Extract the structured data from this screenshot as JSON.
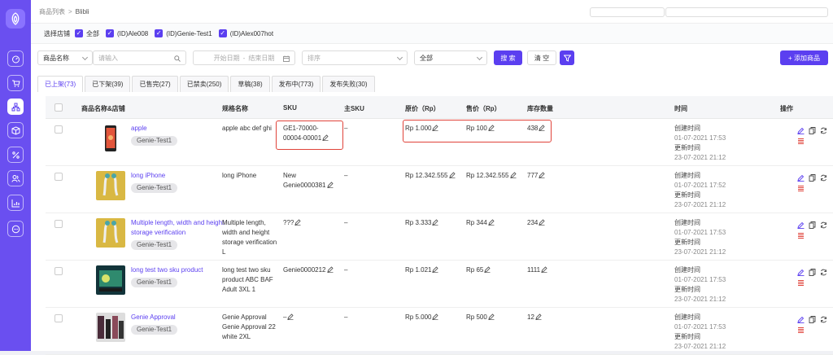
{
  "breadcrumb": {
    "parent": "商品列表",
    "separator": ">",
    "current": "Blibli"
  },
  "stores": {
    "label": "选择店铺",
    "options": [
      "全部",
      "(ID)Ale008",
      "(ID)Genie-Test1",
      "(ID)Alex007hot"
    ]
  },
  "filters": {
    "field": "商品名称",
    "search_placeholder": "请输入",
    "start_date": "开始日期",
    "date_sep": "-",
    "end_date": "结束日期",
    "sort": "排序",
    "status": "全部",
    "search_btn": "搜 索",
    "clear_btn": "清 空",
    "add_btn": "+ 添加商品"
  },
  "tabs": [
    "已上架(73)",
    "已下架(39)",
    "已售完(27)",
    "已禁卖(250)",
    "草稿(38)",
    "发布中(773)",
    "发布失败(30)"
  ],
  "columns": {
    "product": "商品名称&店铺",
    "spec": "规格名称",
    "sku": "SKU",
    "main_sku": "主SKU",
    "orig_price": "原价（Rp）",
    "price": "售价（Rp）",
    "stock": "库存数量",
    "time": "时间",
    "ops": "操作"
  },
  "time_labels": {
    "created": "创建时间",
    "updated": "更新时间"
  },
  "rows": [
    {
      "name": "apple",
      "store": "Genie-Test1",
      "spec": "apple abc def ghi",
      "sku": "GE1-70000-00004-00001",
      "main_sku": "–",
      "orig": "Rp 1.000",
      "price": "Rp 100",
      "stock": "438",
      "created": "01-07-2021 17:53",
      "updated": "23-07-2021 21:12"
    },
    {
      "name": "long iPhone",
      "store": "Genie-Test1",
      "spec": "long iPhone",
      "sku": "New Genie0000381",
      "main_sku": "–",
      "orig": "Rp 12.342.555",
      "price": "Rp 12.342.555",
      "stock": "777",
      "created": "01-07-2021 17:52",
      "updated": "23-07-2021 21:12"
    },
    {
      "name": "Multiple length, width and height storage verification",
      "store": "Genie-Test1",
      "spec": "Multiple length, width and height storage verification L",
      "sku": "???",
      "main_sku": "–",
      "orig": "Rp 3.333",
      "price": "Rp 344",
      "stock": "234",
      "created": "01-07-2021 17:53",
      "updated": "23-07-2021 21:12"
    },
    {
      "name": "long test two sku product",
      "store": "Genie-Test1",
      "spec": "long test two sku product ABC BAF Adult 3XL 1",
      "sku": "Genie0000212",
      "main_sku": "–",
      "orig": "Rp 1.021",
      "price": "Rp 65",
      "stock": "1111",
      "created": "01-07-2021 17:53",
      "updated": "23-07-2021 21:12"
    },
    {
      "name": "Genie Approval",
      "store": "Genie-Test1",
      "spec": "Genie Approval Genie Approval 22 white 2XL",
      "sku": "–",
      "main_sku": "–",
      "orig": "Rp 5.000",
      "price": "Rp 500",
      "stock": "12",
      "created": "01-07-2021 17:53",
      "updated": "23-07-2021 21:12"
    }
  ],
  "colors": {
    "accent": "#5b3ff0",
    "sidebar": "#6a4ff0",
    "highlight": "#e0433a"
  }
}
